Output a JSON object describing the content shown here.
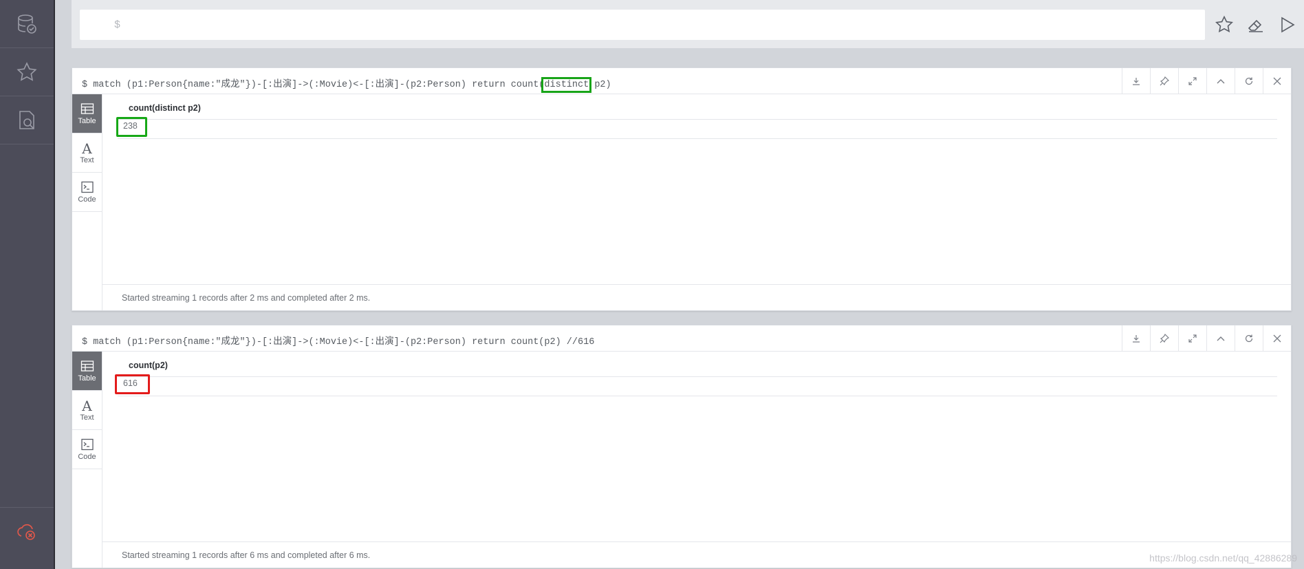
{
  "editor": {
    "prompt": "$"
  },
  "frames": [
    {
      "query_prefix": "$ match (p1:Person{name:\"成龙\"})-[:出演]->(:Movie)<-[:出演]-(p2:Person) return count(",
      "query_highlight": "distinct",
      "query_suffix": " p2)",
      "tabs": {
        "table": "Table",
        "text": "Text",
        "code": "Code"
      },
      "column": "count(distinct p2)",
      "value": "238",
      "status": "Started streaming 1 records after 2 ms and completed after 2 ms."
    },
    {
      "query": "$ match (p1:Person{name:\"成龙\"})-[:出演]->(:Movie)<-[:出演]-(p2:Person) return count(p2) //616",
      "tabs": {
        "table": "Table",
        "text": "Text",
        "code": "Code"
      },
      "column": "count(p2)",
      "value": "616",
      "status": "Started streaming 1 records after 6 ms and completed after 6 ms."
    }
  ],
  "watermark": "https://blog.csdn.net/qq_42886289",
  "colors": {
    "sidebar": "#4c4c59",
    "highlight_green": "#17a817",
    "highlight_red": "#e31b1b",
    "error_icon": "#e5584a"
  }
}
